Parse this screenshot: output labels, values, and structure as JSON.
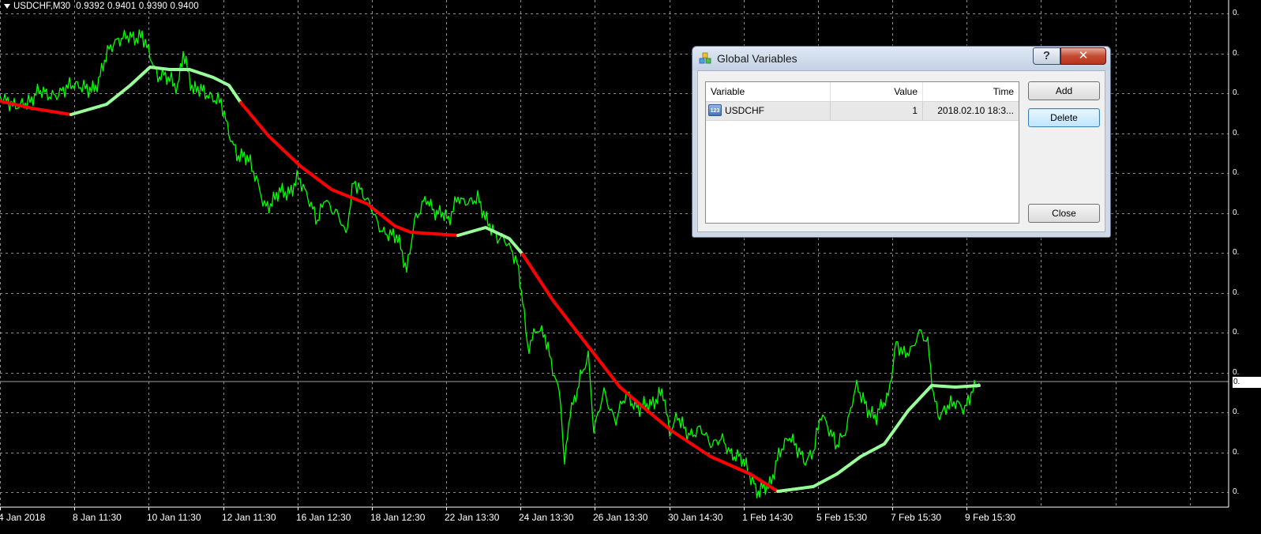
{
  "chart": {
    "symbol_label": "USDCHF,M30",
    "ohlc": "0.9392 0.9401 0.9390 0.9400",
    "colors": {
      "background": "#000000",
      "grid": "#8a8a8a",
      "price": "#00ff00",
      "ma_down": "#ff0000",
      "ma_up": "#99ff99",
      "bid_line": "#a0a0a0"
    },
    "price_axis_labels": [
      "0.",
      "0.",
      "0.",
      "0.",
      "0.",
      "0.",
      "0.",
      "0.",
      "0.",
      "0.",
      "0.",
      "0.",
      "0."
    ],
    "current_price_label": "0.",
    "time_axis_labels": [
      "4 Jan 2018",
      "8 Jan 11:30",
      "10 Jan 11:30",
      "12 Jan 11:30",
      "16 Jan 12:30",
      "18 Jan 12:30",
      "22 Jan 13:30",
      "24 Jan 13:30",
      "26 Jan 13:30",
      "30 Jan 14:30",
      "1 Feb 14:30",
      "5 Feb 15:30",
      "7 Feb 15:30",
      "9 Feb 15:30"
    ]
  },
  "dialog": {
    "title": "Global Variables",
    "help_label": "?",
    "close_label": "✕",
    "columns": [
      "Variable",
      "Value",
      "Time"
    ],
    "rows": [
      {
        "icon_text": "123",
        "variable": "USDCHF",
        "value": "1",
        "time": "2018.02.10 18:3..."
      }
    ],
    "buttons": {
      "add": "Add",
      "delete": "Delete",
      "close": "Close"
    }
  }
}
